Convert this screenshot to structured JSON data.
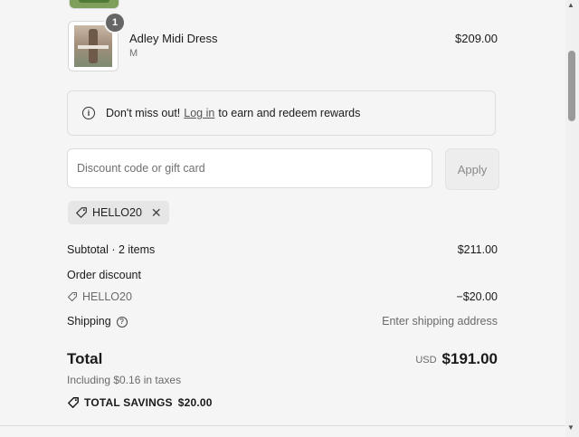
{
  "product": {
    "name": "Adley Midi Dress",
    "variant": "M",
    "price": "$209.00",
    "quantity": "1"
  },
  "rewards": {
    "prefix": "Don't miss out!",
    "link": "Log in",
    "suffix": "to earn and redeem rewards"
  },
  "discount": {
    "placeholder": "Discount code or gift card",
    "apply_label": "Apply",
    "applied_code": "HELLO20"
  },
  "summary": {
    "subtotal_label": "Subtotal · 2 items",
    "subtotal_value": "$211.00",
    "order_discount_label": "Order discount",
    "discount_code": "HELLO20",
    "discount_value": "−$20.00",
    "shipping_label": "Shipping",
    "shipping_value": "Enter shipping address",
    "total_label": "Total",
    "currency": "USD",
    "total_value": "$191.00",
    "taxes_note": "Including $0.16 in taxes",
    "savings_label": "TOTAL SAVINGS",
    "savings_value": "$20.00"
  },
  "icons": {
    "info": "info-icon",
    "tag": "tag-icon",
    "close": "close-icon",
    "help": "help-icon"
  }
}
